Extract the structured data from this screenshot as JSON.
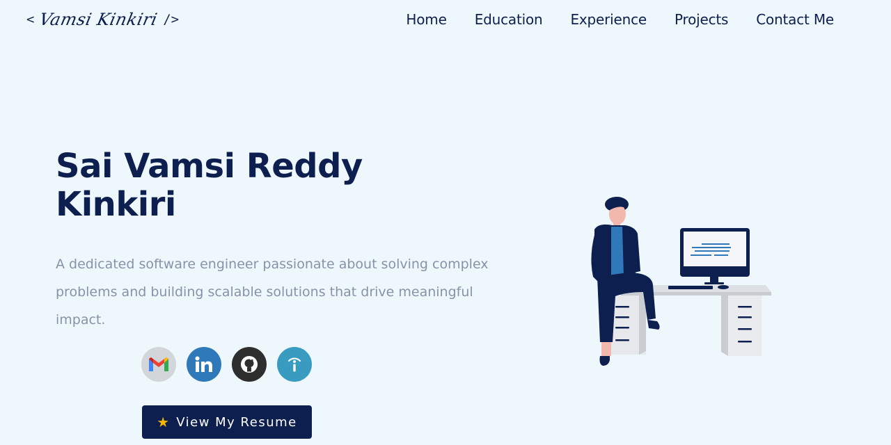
{
  "header": {
    "logo": {
      "open_bracket": "<",
      "signature": "Vamsi Kinkiri",
      "close_bracket": "/>"
    },
    "nav": [
      {
        "label": "Home"
      },
      {
        "label": "Education"
      },
      {
        "label": "Experience"
      },
      {
        "label": "Projects"
      },
      {
        "label": "Contact Me"
      }
    ]
  },
  "hero": {
    "name_line1": "Sai Vamsi Reddy",
    "name_line2": "Kinkiri",
    "description": "A dedicated software engineer passionate about solving complex problems and building scalable solutions that drive meaningful impact.",
    "socials": [
      {
        "icon": "gmail-icon",
        "color": "#d2d6da"
      },
      {
        "icon": "linkedin-icon",
        "color": "#2f78b9"
      },
      {
        "icon": "github-icon",
        "color": "#2e2e2e"
      },
      {
        "icon": "info-icon",
        "color": "#3a9bc1"
      }
    ],
    "resume_button": {
      "star": "★",
      "label": "View My Resume"
    }
  },
  "colors": {
    "background": "#eef8fc",
    "primary": "#0d1f4f",
    "muted_text": "#8792a8"
  }
}
